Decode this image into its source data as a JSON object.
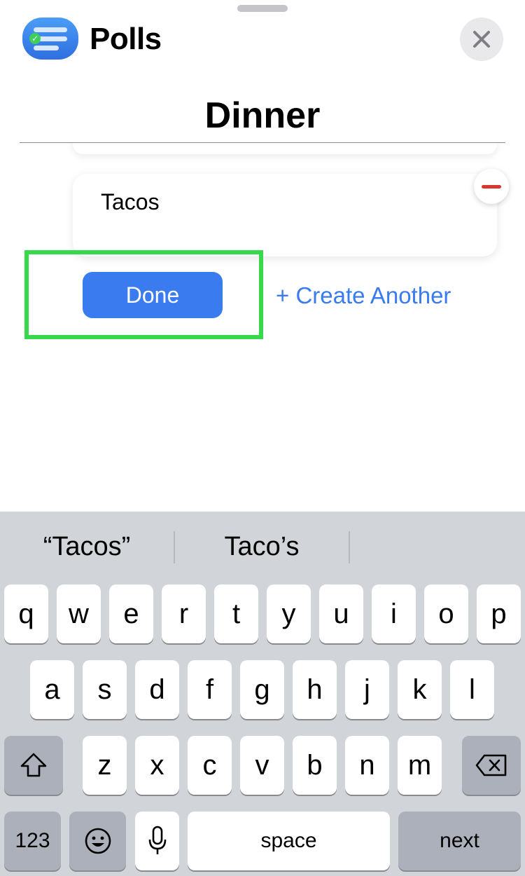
{
  "header": {
    "app_icon": "polls-app-icon",
    "title": "Polls",
    "close_icon": "close-icon"
  },
  "poll": {
    "title": "Dinner",
    "option_value": "Tacos",
    "remove_icon": "minus-icon"
  },
  "actions": {
    "done_label": "Done",
    "create_another_label": "+ Create Another"
  },
  "colors": {
    "accent": "#3a7cf0",
    "highlight": "#35d94a",
    "remove": "#d9372e"
  },
  "keyboard": {
    "suggestions": [
      "“Tacos”",
      "Taco’s",
      ""
    ],
    "row1": [
      "q",
      "w",
      "e",
      "r",
      "t",
      "y",
      "u",
      "i",
      "o",
      "p"
    ],
    "row2": [
      "a",
      "s",
      "d",
      "f",
      "g",
      "h",
      "j",
      "k",
      "l"
    ],
    "row3": [
      "z",
      "x",
      "c",
      "v",
      "b",
      "n",
      "m"
    ],
    "shift_icon": "shift-icon",
    "backspace_icon": "backspace-icon",
    "numbers_label": "123",
    "emoji_icon": "emoji-icon",
    "mic_icon": "microphone-icon",
    "space_label": "space",
    "return_label": "next"
  }
}
